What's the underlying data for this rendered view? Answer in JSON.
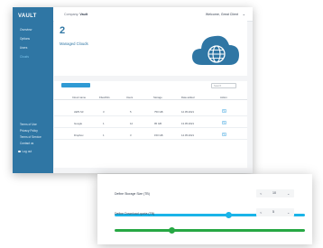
{
  "sidebar": {
    "logo": "VAULT",
    "items": [
      {
        "label": "Overview"
      },
      {
        "label": "Options"
      },
      {
        "label": "Users"
      },
      {
        "label": "Clouds"
      }
    ],
    "footer_items": [
      {
        "label": "Terms of Use"
      },
      {
        "label": "Privacy Policy"
      },
      {
        "label": "Terms of Service"
      },
      {
        "label": "Contact us"
      },
      {
        "label": "Log out"
      }
    ]
  },
  "header": {
    "company_label": "Company:",
    "company_name": "Vault",
    "welcome_text": "Welcome, Great Client"
  },
  "summary": {
    "count": "2",
    "label": "Managed Clouds"
  },
  "table": {
    "search_placeholder": "Search",
    "columns": [
      "Cloud name",
      "Files/Dirs",
      "Users",
      "Storage",
      "Date added",
      "Action"
    ],
    "rows": [
      [
        "AWS S3",
        "3",
        "5",
        "750 GB",
        "12.05.2021"
      ],
      [
        "Google",
        "1",
        "12",
        "95 GB",
        "13.05.2021"
      ],
      [
        "Dropbox",
        "1",
        "3",
        "150 GB",
        "14.05.2021"
      ]
    ]
  },
  "modal": {
    "storage_label": "Define Storage Size (TB)",
    "storage_value": "10",
    "storage_fraction": 0.6,
    "storage_color": "#1ab4e8",
    "download_label": "Define Download quota (TB)",
    "download_value": "5",
    "download_fraction": 0.3,
    "download_color": "#27a844"
  },
  "colors": {
    "sidebar": "#2f76a4",
    "accent": "#2f9ad4"
  }
}
